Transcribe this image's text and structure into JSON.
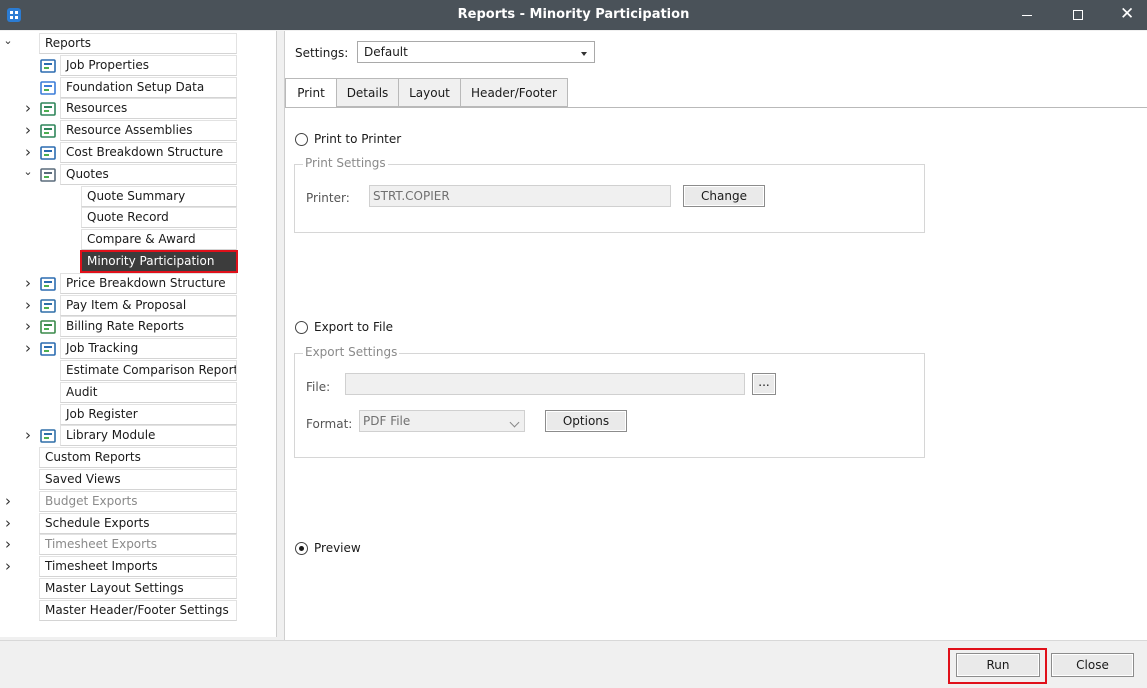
{
  "window": {
    "title": "Reports - Minority Participation"
  },
  "tree": {
    "root_label": "Reports",
    "job_items": [
      {
        "label": "Job Properties",
        "icon": "job-properties-icon",
        "expander": ""
      },
      {
        "label": "Foundation Setup Data",
        "icon": "foundation-setup-icon",
        "expander": ""
      },
      {
        "label": "Resources",
        "icon": "resources-icon",
        "expander": "closed"
      },
      {
        "label": "Resource Assemblies",
        "icon": "resource-assemblies-icon",
        "expander": "closed"
      },
      {
        "label": "Cost Breakdown Structure",
        "icon": "cost-breakdown-icon",
        "expander": "closed"
      },
      {
        "label": "Quotes",
        "icon": "quotes-icon",
        "expander": "open"
      }
    ],
    "quote_children": [
      {
        "label": "Quote Summary",
        "selected": false
      },
      {
        "label": "Quote Record",
        "selected": false
      },
      {
        "label": "Compare & Award",
        "selected": false
      },
      {
        "label": "Minority Participation",
        "selected": true
      }
    ],
    "job_items_2": [
      {
        "label": "Price Breakdown Structure",
        "icon": "price-breakdown-icon",
        "expander": "closed"
      },
      {
        "label": "Pay Item & Proposal",
        "icon": "pay-item-icon",
        "expander": "closed"
      },
      {
        "label": "Billing Rate Reports",
        "icon": "billing-rate-icon",
        "expander": "closed"
      },
      {
        "label": "Job Tracking",
        "icon": "job-tracking-icon",
        "expander": "closed"
      },
      {
        "label": "Estimate Comparison Report",
        "icon": "",
        "expander": ""
      },
      {
        "label": "Audit",
        "icon": "",
        "expander": ""
      },
      {
        "label": "Job Register",
        "icon": "",
        "expander": ""
      },
      {
        "label": "Library Module",
        "icon": "library-module-icon",
        "expander": "closed"
      }
    ],
    "top_items": [
      {
        "label": "Custom Reports",
        "expander": "",
        "disabled": false
      },
      {
        "label": "Saved Views",
        "expander": "",
        "disabled": false
      },
      {
        "label": "Budget Exports",
        "expander": "closed",
        "disabled": true
      },
      {
        "label": "Schedule Exports",
        "expander": "closed",
        "disabled": false
      },
      {
        "label": "Timesheet Exports",
        "expander": "closed",
        "disabled": true
      },
      {
        "label": "Timesheet Imports",
        "expander": "closed",
        "disabled": false
      },
      {
        "label": "Master Layout Settings",
        "expander": "",
        "disabled": false
      },
      {
        "label": "Master Header/Footer Settings",
        "expander": "",
        "disabled": false
      }
    ]
  },
  "settings": {
    "label": "Settings:",
    "value": "Default"
  },
  "tabs": [
    {
      "label": "Print",
      "active": true
    },
    {
      "label": "Details",
      "active": false
    },
    {
      "label": "Layout",
      "active": false
    },
    {
      "label": "Header/Footer",
      "active": false
    }
  ],
  "print": {
    "print_to_printer": "Print to Printer",
    "print_settings_title": "Print Settings",
    "printer_label": "Printer:",
    "printer_value": "STRT.COPIER",
    "change_label": "Change",
    "export_to_file": "Export to File",
    "export_settings_title": "Export Settings",
    "file_label": "File:",
    "file_value": "",
    "browse_label": "...",
    "format_label": "Format:",
    "format_value": "PDF File",
    "options_label": "Options",
    "preview_label": "Preview",
    "selected_output": "Preview"
  },
  "footer": {
    "run_label": "Run",
    "close_label": "Close"
  },
  "colors": {
    "titlebar": "#4a5259",
    "selection": "#3c3c3c",
    "highlight_border": "#e0101a"
  }
}
